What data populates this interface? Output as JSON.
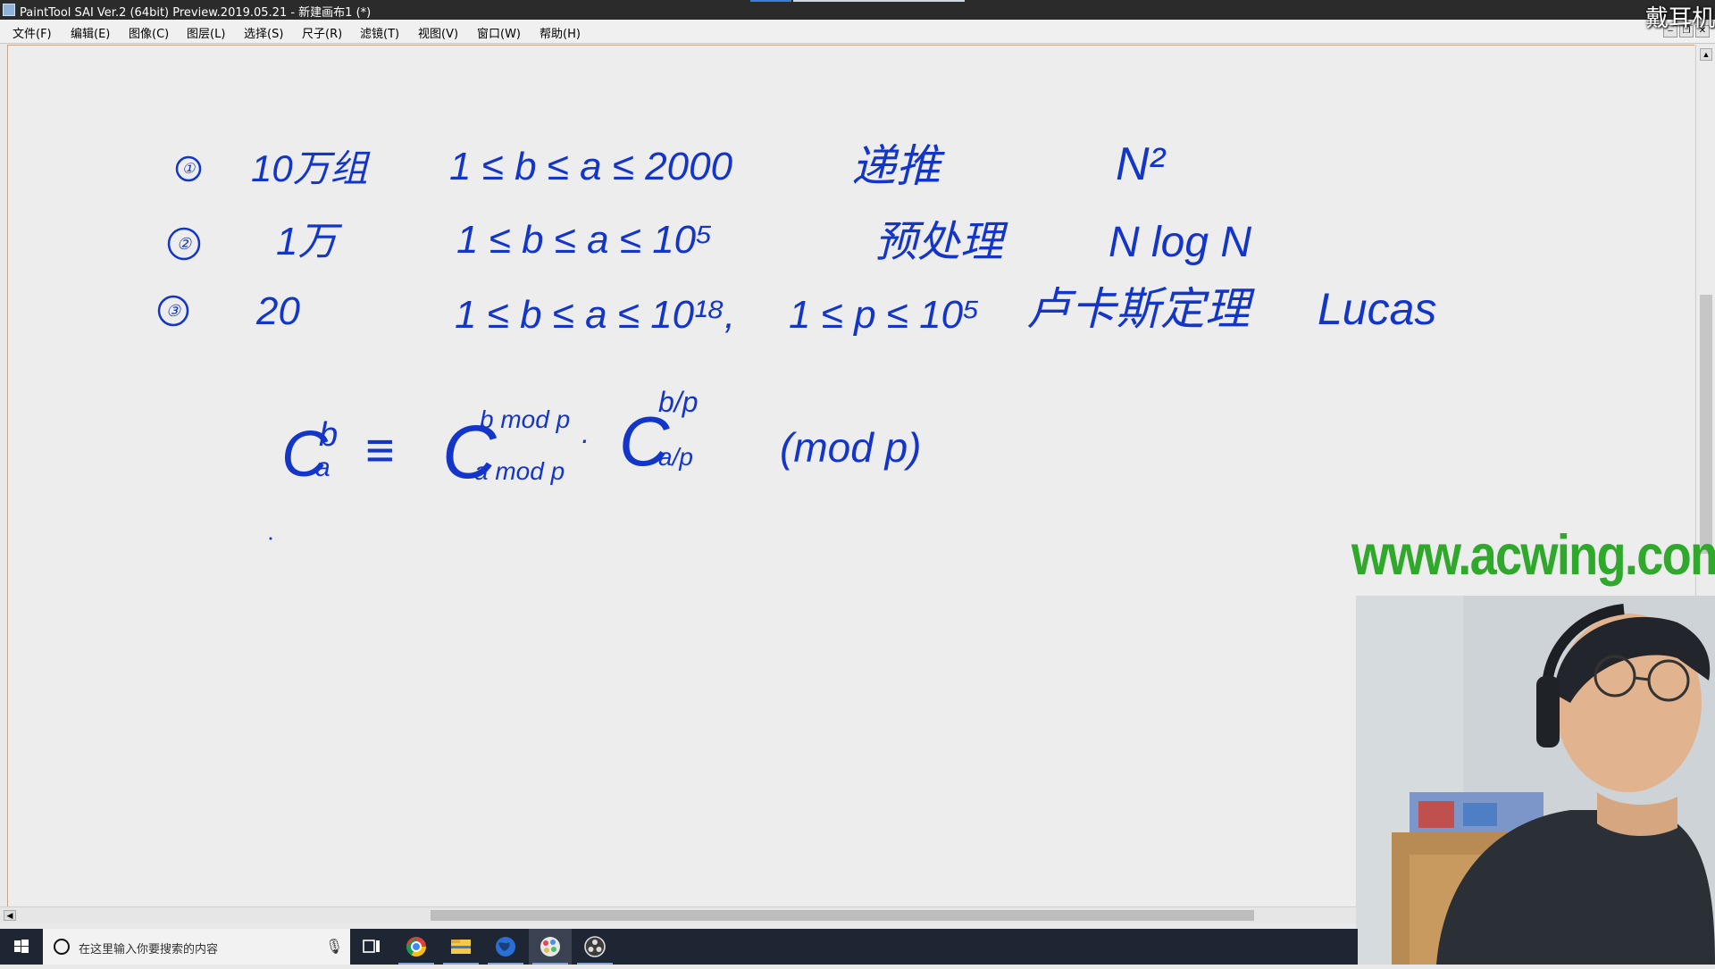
{
  "window": {
    "title": "PaintTool SAI Ver.2 (64bit) Preview.2019.05.21 - 新建画布1 (*)",
    "top_right_overlay": "戴耳机"
  },
  "menu": {
    "items": [
      "文件(F)",
      "编辑(E)",
      "图像(C)",
      "图层(L)",
      "选择(S)",
      "尺子(R)",
      "滤镜(T)",
      "视图(V)",
      "窗口(W)",
      "帮助(H)"
    ]
  },
  "canvas": {
    "rows": [
      {
        "index": "①",
        "count": "10万组",
        "range": "1 ≤ b ≤ a ≤ 2000",
        "method": "递推",
        "complexity": "N²"
      },
      {
        "index": "②",
        "count": "1万",
        "range": "1 ≤ b ≤ a ≤ 10⁵",
        "method": "预处理",
        "complexity": "N log N"
      },
      {
        "index": "③",
        "count": "20",
        "range": "1 ≤ b ≤ a ≤ 10¹⁸,",
        "range2": "1 ≤ p ≤ 10⁵",
        "method": "卢卡斯定理",
        "complexity": "Lucas"
      }
    ],
    "formula": {
      "lhs_base": "C",
      "lhs_sup": "b",
      "lhs_sub": "a",
      "equiv": "≡",
      "t1_base": "C",
      "t1_sup": "b mod p",
      "t1_sub": "a mod p",
      "dot": "·",
      "t2_base": "C",
      "t2_sup": "b/p",
      "t2_sub": "a/p",
      "mod": "(mod p)"
    },
    "ink_color": "#1436c8"
  },
  "brand": {
    "text": "www.acwing.com",
    "color": "#2fa82b"
  },
  "taskbar": {
    "search_placeholder": "在这里输入你要搜索的内容",
    "apps": [
      "task-view",
      "chrome",
      "file-explorer",
      "network-globe",
      "painttool-sai",
      "obs"
    ]
  }
}
